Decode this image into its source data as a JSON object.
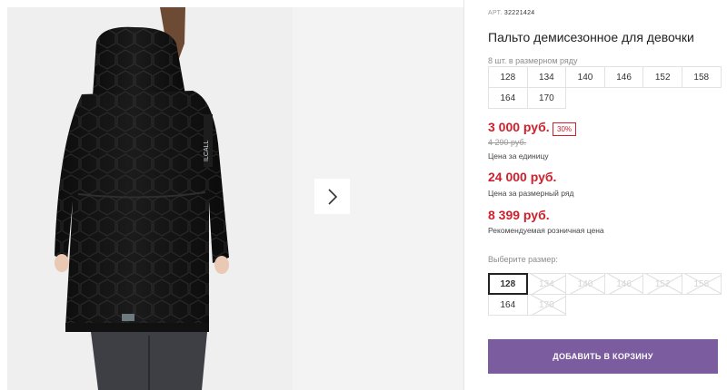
{
  "product": {
    "article_label": "АРТ.",
    "article_number": "32221424",
    "title": "Пальто демисезонное для девочки",
    "pack_note": "8 шт. в размерном ряду",
    "pack_sizes": [
      "128",
      "134",
      "140",
      "146",
      "152",
      "158",
      "164",
      "170"
    ]
  },
  "pricing": {
    "unit_price": "3 000 руб.",
    "discount": "30%",
    "old_price": "4 290 руб.",
    "unit_caption": "Цена за единицу",
    "row_price": "24 000 руб.",
    "row_caption": "Цена за размерный ряд",
    "retail_price": "8 399 руб.",
    "retail_caption": "Рекомендуемая розничная цена",
    "accent_color": "#d0202c"
  },
  "size_select": {
    "label": "Выберите размер:",
    "options": [
      {
        "label": "128",
        "state": "selected"
      },
      {
        "label": "134",
        "state": "disabled"
      },
      {
        "label": "140",
        "state": "disabled"
      },
      {
        "label": "146",
        "state": "disabled"
      },
      {
        "label": "152",
        "state": "disabled"
      },
      {
        "label": "158",
        "state": "disabled"
      },
      {
        "label": "164",
        "state": "available"
      },
      {
        "label": "170",
        "state": "disabled"
      }
    ]
  },
  "cart": {
    "add_label": "ДОБАВИТЬ В КОРЗИНУ",
    "button_color": "#7b5c9f"
  },
  "gallery": {
    "next_icon": "chevron-right-icon"
  }
}
